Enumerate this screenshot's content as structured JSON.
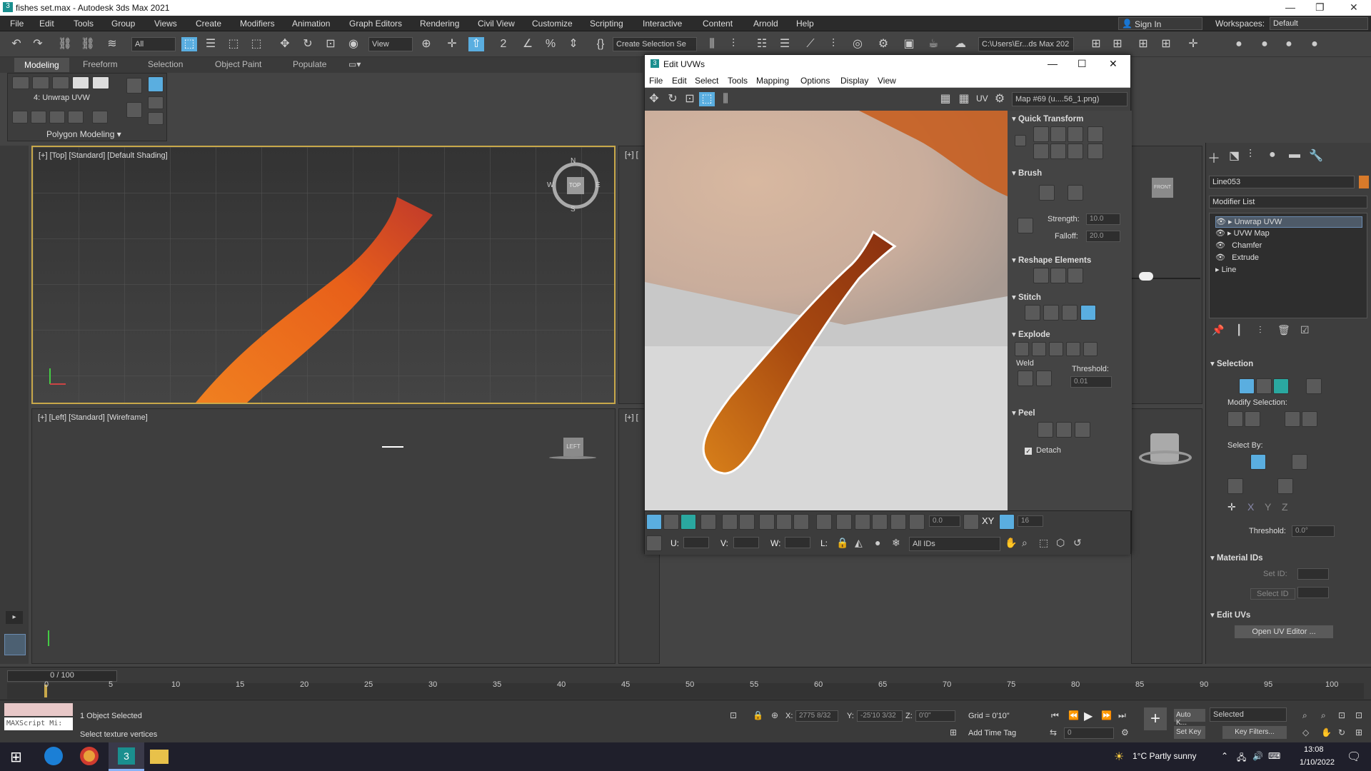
{
  "titlebar": {
    "title": "fishes set.max - Autodesk 3ds Max 2021"
  },
  "menubar": {
    "items": [
      "File",
      "Edit",
      "Tools",
      "Group",
      "Views",
      "Create",
      "Modifiers",
      "Animation",
      "Graph Editors",
      "Rendering",
      "Civil View",
      "Customize",
      "Scripting",
      "Interactive",
      "Content",
      "Arnold",
      "Help"
    ],
    "sign_in": "Sign In",
    "workspaces_label": "Workspaces:",
    "workspaces_value": "Default"
  },
  "toolbar": {
    "filter_value": "All",
    "ref_coord_value": "View",
    "selection_set_placeholder": "Create Selection Se",
    "project_path": "C:\\Users\\Er...ds Max 202"
  },
  "ribbon": {
    "tabs": [
      "Modeling",
      "Freeform",
      "Selection",
      "Object Paint",
      "Populate"
    ],
    "modifier_label": "4: Unwrap UVW",
    "polygon_modeling": "Polygon Modeling"
  },
  "viewports": {
    "top_label": "[+] [Top] [Standard] [Default Shading]",
    "left_label": "[+] [Left] [Standard] [Wireframe]",
    "right_top_label": "[+] [",
    "right_bottom_label": "[+] [",
    "compass": {
      "n": "N",
      "s": "S",
      "e": "E",
      "w": "W",
      "cube": "TOP"
    },
    "left_cube": "LEFT",
    "front_cube": "FRONT"
  },
  "uvw_editor": {
    "title": "Edit UVWs",
    "menus": [
      "File",
      "Edit",
      "Select",
      "Tools",
      "Mapping",
      "Options",
      "Display",
      "View"
    ],
    "uv_label": "UV",
    "map_dropdown": "Map #69 (u....56_1.png)",
    "rollouts": {
      "quick_transform": "Quick Transform",
      "brush": "Brush",
      "strength_label": "Strength:",
      "strength_value": "10.0",
      "falloff_label": "Falloff:",
      "falloff_value": "20.0",
      "reshape": "Reshape Elements",
      "stitch": "Stitch",
      "explode": "Explode",
      "weld": "Weld",
      "threshold_label": "Threshold:",
      "threshold_value": "0.01",
      "peel": "Peel",
      "detach": "Detach"
    },
    "bottom": {
      "spin_value": "0.0",
      "xy_label": "XY",
      "grid_value": "16",
      "u_label": "U:",
      "v_label": "V:",
      "w_label": "W:",
      "l_label": "L:",
      "ids_value": "All IDs"
    }
  },
  "command_panel": {
    "object_name": "Line053",
    "modifier_list": "Modifier List",
    "stack": [
      "Unwrap UVW",
      "UVW Map",
      "Chamfer",
      "Extrude",
      "Line"
    ],
    "selection_head": "Selection",
    "modify_selection": "Modify Selection:",
    "select_by": "Select By:",
    "threshold_label": "Threshold:",
    "threshold_value": "0.0°",
    "material_ids": "Material IDs",
    "set_id": "Set ID:",
    "select_id": "Select ID",
    "edit_uvs": "Edit UVs",
    "open_uv_editor": "Open UV Editor ..."
  },
  "timeline": {
    "frame_counter": "0 / 100",
    "ticks": [
      "0",
      "5",
      "10",
      "15",
      "20",
      "25",
      "30",
      "35",
      "40",
      "45",
      "50",
      "55",
      "60",
      "65",
      "70",
      "75",
      "80",
      "85",
      "90",
      "95",
      "100"
    ]
  },
  "statusbar": {
    "maxscript": "MAXScript Mi:",
    "selected_count": "1 Object Selected",
    "prompt": "Select texture vertices",
    "x_label": "X:",
    "x_value": "2775 8/32",
    "y_label": "Y:",
    "y_value": "-25'10 3/32",
    "z_label": "Z:",
    "z_value": "0'0\"",
    "grid": "Grid = 0'10\"",
    "add_time_tag": "Add Time Tag",
    "auto_key": "Auto K...",
    "selected_dropdown": "Selected",
    "set_key": "Set Key",
    "key_filters": "Key Filters...",
    "frame_value": "0"
  },
  "taskbar": {
    "weather": "1°C  Partly sunny",
    "time": "13:08",
    "date": "1/10/2022"
  },
  "colors": {
    "accent_blue": "#5aaee0",
    "selection_frame": "#c8a84a",
    "fish_fin_orange": "#e8701a"
  }
}
